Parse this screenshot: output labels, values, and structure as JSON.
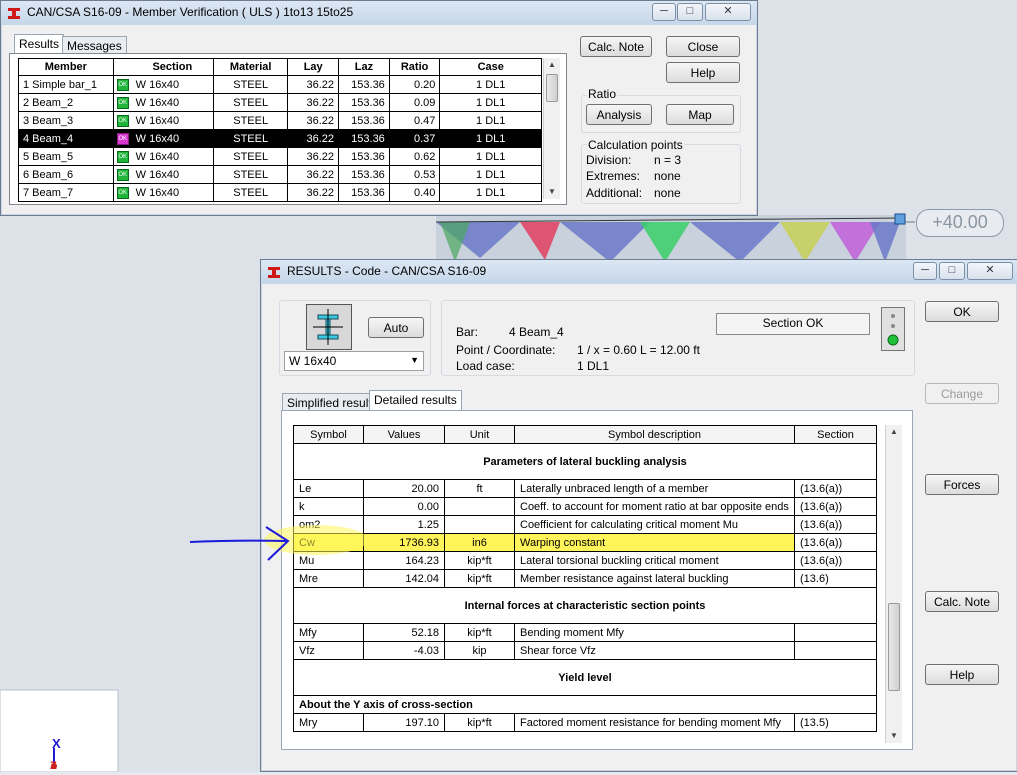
{
  "top_window": {
    "title": "CAN/CSA S16-09 - Member Verification ( ULS ) 1to13 15to25",
    "tabs": [
      "Results",
      "Messages"
    ],
    "columns": [
      "Member",
      "Section",
      "Material",
      "Lay",
      "Laz",
      "Ratio",
      "Case"
    ],
    "rows": [
      {
        "member": "1  Simple bar_1",
        "status": "OK",
        "section": "W 16x40",
        "material": "STEEL",
        "lay": "36.22",
        "laz": "153.36",
        "ratio": "0.20",
        "case": "1 DL1"
      },
      {
        "member": "2  Beam_2",
        "status": "OK",
        "section": "W 16x40",
        "material": "STEEL",
        "lay": "36.22",
        "laz": "153.36",
        "ratio": "0.09",
        "case": "1 DL1"
      },
      {
        "member": "3  Beam_3",
        "status": "OK",
        "section": "W 16x40",
        "material": "STEEL",
        "lay": "36.22",
        "laz": "153.36",
        "ratio": "0.47",
        "case": "1 DL1"
      },
      {
        "member": "4  Beam_4",
        "status": "OK",
        "section": "W 16x40",
        "material": "STEEL",
        "lay": "36.22",
        "laz": "153.36",
        "ratio": "0.37",
        "case": "1 DL1",
        "selected": true
      },
      {
        "member": "5  Beam_5",
        "status": "OK",
        "section": "W 16x40",
        "material": "STEEL",
        "lay": "36.22",
        "laz": "153.36",
        "ratio": "0.62",
        "case": "1 DL1"
      },
      {
        "member": "6  Beam_6",
        "status": "OK",
        "section": "W 16x40",
        "material": "STEEL",
        "lay": "36.22",
        "laz": "153.36",
        "ratio": "0.53",
        "case": "1 DL1"
      },
      {
        "member": "7  Beam_7",
        "status": "OK",
        "section": "W 16x40",
        "material": "STEEL",
        "lay": "36.22",
        "laz": "153.36",
        "ratio": "0.40",
        "case": "1 DL1"
      }
    ],
    "buttons": {
      "calc_note": "Calc. Note",
      "close": "Close",
      "help": "Help",
      "analysis": "Analysis",
      "map": "Map"
    },
    "ratio_group": "Ratio",
    "calc_points": {
      "title": "Calculation points",
      "division_label": "Division:",
      "division_value": "n = 3",
      "extremes_label": "Extremes:",
      "extremes_value": "none",
      "additional_label": "Additional:",
      "additional_value": "none"
    }
  },
  "viewport": {
    "dimension_label": "+40.00",
    "axis_label": "X",
    "axis_label_z": "Z"
  },
  "results_window": {
    "title": "RESULTS - Code - CAN/CSA S16-09",
    "auto_button": "Auto",
    "section_select": "W 16x40",
    "bar_label": "Bar:",
    "bar_value": "4  Beam_4",
    "point_label": "Point / Coordinate:",
    "point_value": "1 / x = 0.60 L = 12.00 ft",
    "load_label": "Load case:",
    "load_value": "1 DL1",
    "section_status": "Section OK",
    "tabs": [
      "Simplified results",
      "Detailed results"
    ],
    "buttons": {
      "ok": "OK",
      "change": "Change",
      "forces": "Forces",
      "calc_note": "Calc. Note",
      "help": "Help"
    },
    "columns": [
      "Symbol",
      "Values",
      "Unit",
      "Symbol description",
      "Section"
    ],
    "section_lateral": "Parameters of lateral buckling analysis",
    "rows_lateral": [
      {
        "symbol": "Le",
        "value": "20.00",
        "unit": "ft",
        "desc": "Laterally unbraced length of a member",
        "section": "(13.6(a))"
      },
      {
        "symbol": "k",
        "value": "0.00",
        "unit": "",
        "desc": "Coeff. to account for moment ratio at bar opposite ends",
        "section": "(13.6(a))"
      },
      {
        "symbol": "om2",
        "value": "1.25",
        "unit": "",
        "desc": "Coefficient for calculating critical moment Mu",
        "section": "(13.6(a))"
      },
      {
        "symbol": "Cw",
        "value": "1736.93",
        "unit": "in6",
        "desc": "Warping constant",
        "section": "(13.6(a))",
        "highlight": true
      },
      {
        "symbol": "Mu",
        "value": "164.23",
        "unit": "kip*ft",
        "desc": "Lateral torsional buckling critical moment",
        "section": "(13.6(a))"
      },
      {
        "symbol": "Mre",
        "value": "142.04",
        "unit": "kip*ft",
        "desc": "Member resistance against lateral buckling",
        "section": "(13.6)"
      }
    ],
    "section_internal": "Internal forces at characteristic section points",
    "rows_internal": [
      {
        "symbol": "Mfy",
        "value": "52.18",
        "unit": "kip*ft",
        "desc": "Bending moment Mfy",
        "section": ""
      },
      {
        "symbol": "Vfz",
        "value": "-4.03",
        "unit": "kip",
        "desc": "Shear force Vfz",
        "section": ""
      }
    ],
    "section_yield": "Yield level",
    "subheader_y": "About the Y axis of cross-section",
    "rows_yield": [
      {
        "symbol": "Mry",
        "value": "197.10",
        "unit": "kip*ft",
        "desc": "Factored moment resistance for bending moment Mfy",
        "section": "(13.5)"
      }
    ]
  },
  "colors": {
    "highlight": "#fff55a",
    "ok_green": "#1fb43a",
    "annotation_blue": "#1a1ad8",
    "selected_row": "#000000"
  }
}
